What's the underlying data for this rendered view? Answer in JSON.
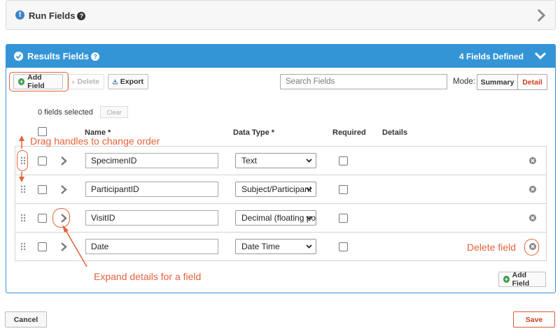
{
  "run_fields": {
    "title": "Run Fields",
    "info_icon": "info-circle-icon",
    "help_icon": "question-icon"
  },
  "results_fields": {
    "title": "Results Fields",
    "count_label": "4 Fields Defined",
    "toolbar": {
      "add_field": "Add Field",
      "delete": "Delete",
      "export": "Export",
      "search_placeholder": "Search Fields",
      "mode_label": "Mode:",
      "mode_summary": "Summary",
      "mode_detail": "Detail",
      "selected_mode": "Detail"
    },
    "selection": {
      "count_text": "0 fields selected",
      "clear": "Clear"
    },
    "columns": {
      "name": "Name *",
      "data_type": "Data Type *",
      "required": "Required",
      "details": "Details"
    },
    "fields": [
      {
        "name": "SpecimenID",
        "data_type": "Text",
        "required": false
      },
      {
        "name": "ParticipantID",
        "data_type": "Subject/Participant",
        "required": false
      },
      {
        "name": "VisitID",
        "data_type": "Decimal (floating point)",
        "required": false
      },
      {
        "name": "Date",
        "data_type": "Date Time",
        "required": false
      }
    ],
    "bottom_add_field": "Add Field"
  },
  "footer": {
    "cancel": "Cancel",
    "save": "Save"
  },
  "annotations": {
    "drag": "Drag handles to change order",
    "delete": "Delete field",
    "expand": "Expand details for a field"
  },
  "colors": {
    "accent": "#3495d6",
    "annotation": "#e5623a",
    "save": "#c93f1c"
  }
}
